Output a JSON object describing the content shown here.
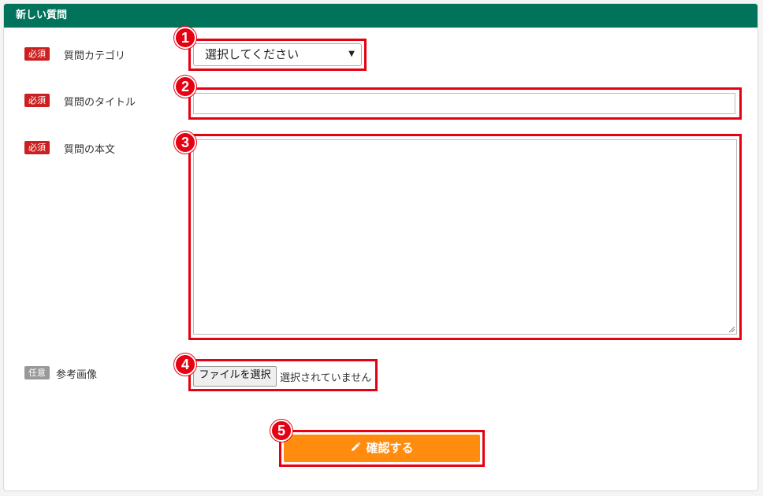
{
  "panel": {
    "title": "新しい質問"
  },
  "fields": {
    "category": {
      "badge": "必須",
      "label": "質問カテゴリ",
      "selected": "選択してください",
      "marker": "1"
    },
    "title": {
      "badge": "必須",
      "label": "質問のタイトル",
      "value": "",
      "marker": "2"
    },
    "body": {
      "badge": "必須",
      "label": "質問の本文",
      "value": "",
      "marker": "3"
    },
    "image": {
      "badge": "任意",
      "label": "参考画像",
      "button_label": "ファイルを選択",
      "status": "選択されていません",
      "marker": "4"
    }
  },
  "submit": {
    "label": "確認する",
    "icon": "pencil-icon",
    "marker": "5"
  },
  "colors": {
    "header": "#00735a",
    "required_badge": "#cc1f1f",
    "optional_badge": "#999999",
    "highlight": "#e60012",
    "submit": "#ff8c0f"
  }
}
